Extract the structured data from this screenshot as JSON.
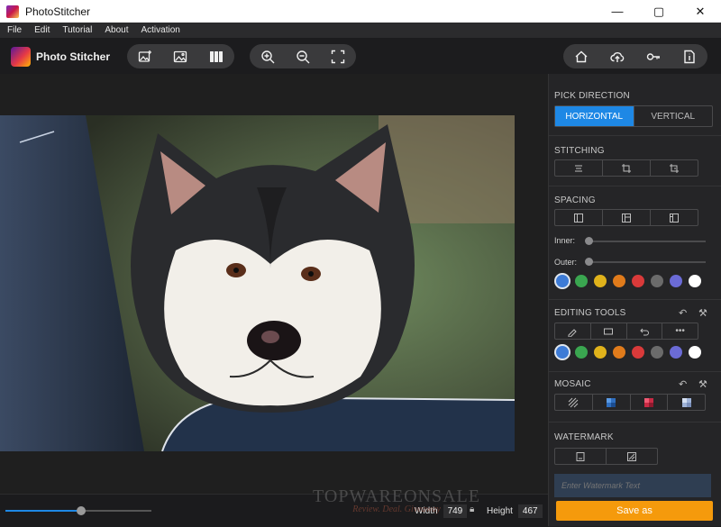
{
  "window": {
    "title": "PhotoStitcher"
  },
  "menu": [
    "File",
    "Edit",
    "Tutorial",
    "About",
    "Activation"
  ],
  "brand": {
    "name": "Photo Stitcher"
  },
  "toolbar": {
    "group1": [
      "add-image-icon",
      "replace-image-icon",
      "columns-icon"
    ],
    "group2": [
      "zoom-in-icon",
      "zoom-out-icon",
      "fit-screen-icon"
    ],
    "group3": [
      "home-icon",
      "upload-cloud-icon",
      "key-icon",
      "info-icon"
    ]
  },
  "panel": {
    "pick_direction": {
      "title": "PICK DIRECTION",
      "options": [
        "HORIZONTAL",
        "VERTICAL"
      ],
      "selected": "HORIZONTAL"
    },
    "stitching": {
      "title": "STITCHING",
      "icons": [
        "align-lines-icon",
        "crop-icon",
        "crop-alt-icon"
      ]
    },
    "spacing": {
      "title": "SPACING",
      "icons": [
        "layout-left-icon",
        "layout-center-icon",
        "layout-right-icon"
      ],
      "inner_label": "Inner:",
      "outer_label": "Outer:",
      "inner_value": 0,
      "outer_value": 0
    },
    "colors": [
      "#3d7bd6",
      "#3aa650",
      "#e0b21b",
      "#e07b1b",
      "#d93a3a",
      "#6b6b6b",
      "#6b6bd6",
      "#ffffff"
    ],
    "editing_tools": {
      "title": "EDITING TOOLS",
      "icons": [
        "pen-icon",
        "rectangle-icon",
        "undo-arrow-icon",
        "more-icon"
      ]
    },
    "mosaic": {
      "title": "MOSAIC",
      "icons": [
        "mosaic-hatch-icon",
        "mosaic-blue-icon",
        "mosaic-red-icon",
        "mosaic-light-icon"
      ]
    },
    "watermark": {
      "title": "WATERMARK",
      "icons": [
        "text-watermark-icon",
        "image-watermark-icon"
      ],
      "placeholder": "Enter Watermark Text"
    }
  },
  "bottom": {
    "zoom_fraction": 0.52,
    "width_label": "Width",
    "width_value": "749",
    "height_label": "Height",
    "height_value": "467",
    "save_label": "Save as",
    "watermark_main": "TOPWAREONSALE",
    "watermark_sub": "Review. Deal. Giveaway"
  }
}
